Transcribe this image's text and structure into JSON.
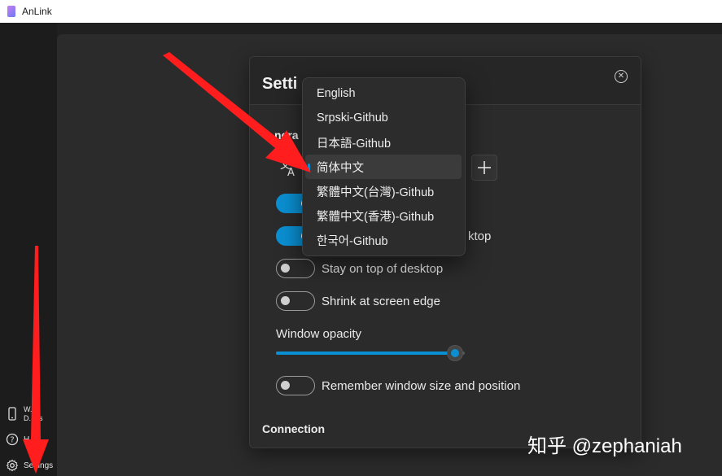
{
  "app": {
    "title": "AnLink"
  },
  "sidebar": {
    "items": [
      {
        "icon": "phone-icon",
        "label": "W... D...es"
      },
      {
        "icon": "help-icon",
        "label": "H..."
      },
      {
        "icon": "gear-icon",
        "label": "Settings"
      }
    ]
  },
  "dialog": {
    "title": "Setti",
    "close_icon": "close-circle-icon",
    "general_title": "nera",
    "connection_title": "Connection",
    "language_icon": "translate-icon",
    "add_icon": "plus-icon",
    "toggles": [
      {
        "label": "",
        "on": true
      },
      {
        "label": "ktop",
        "on": true
      },
      {
        "label": "Stay on top of desktop",
        "on": false
      },
      {
        "label": "Shrink at screen edge",
        "on": false
      }
    ],
    "opacity": {
      "label": "Window opacity",
      "value": 0.95
    },
    "remember": {
      "label": "Remember window size and position",
      "on": false
    }
  },
  "language_dropdown": {
    "options": [
      "English",
      "Srpski-Github",
      "日本語-Github",
      "简体中文",
      "繁體中文(台灣)-Github",
      "繁體中文(香港)-Github",
      "한국어-Github"
    ],
    "selected_index": 3
  },
  "watermark": "知乎 @zephaniah",
  "colors": {
    "accent": "#0a8fd2",
    "arrow": "#ff1d1d",
    "background": "#202020"
  }
}
